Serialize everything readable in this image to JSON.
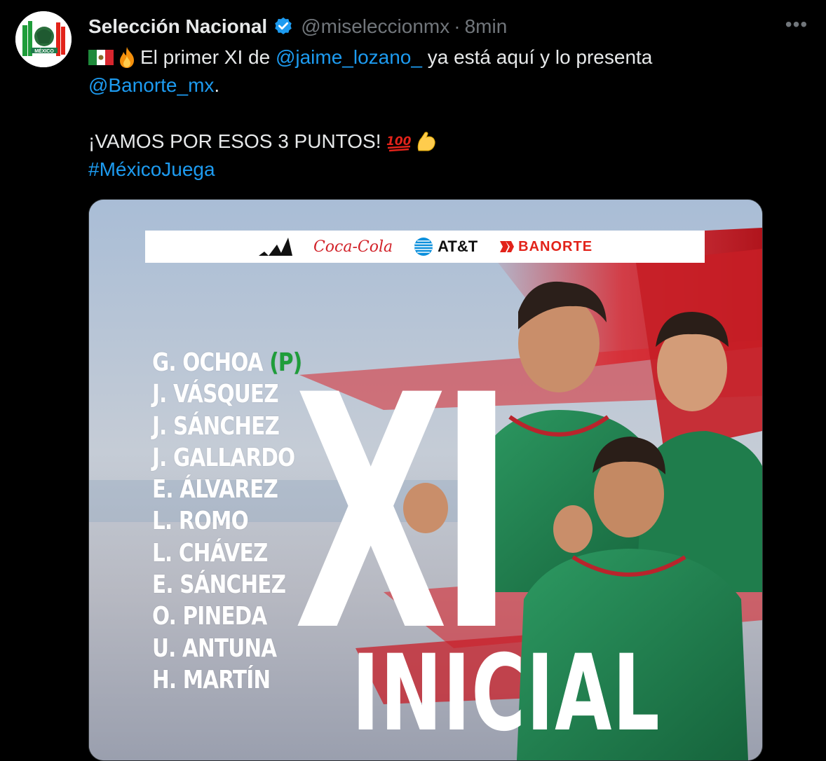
{
  "author": {
    "name": "Selección Nacional",
    "handle": "@miseleccionmx",
    "separator": "·",
    "time": "8min",
    "avatar_icon": "mexico-crest-icon"
  },
  "more_label": "•••",
  "tweet": {
    "line1_prefix": "El primer XI de ",
    "line1_mention": "@jaime_lozano_",
    "line1_suffix": " ya está aquí y lo presenta",
    "line2_mention": "@Banorte_mx",
    "line2_suffix": ".",
    "line3_text": "¡VAMOS POR ESOS 3 PUNTOS! ",
    "hashtag": "#MéxicoJuega"
  },
  "graphic": {
    "sponsors": {
      "coke": "Coca-Cola",
      "att": "AT&T",
      "banorte": "BANORTE"
    },
    "players": [
      {
        "name": "G. OCHOA ",
        "tag": "(P)"
      },
      {
        "name": "J. VÁSQUEZ",
        "tag": ""
      },
      {
        "name": "J. SÁNCHEZ",
        "tag": ""
      },
      {
        "name": "J. GALLARDO",
        "tag": ""
      },
      {
        "name": "E. ÁLVAREZ",
        "tag": ""
      },
      {
        "name": "L. ROMO",
        "tag": ""
      },
      {
        "name": "L. CHÁVEZ",
        "tag": ""
      },
      {
        "name": "E. SÁNCHEZ",
        "tag": ""
      },
      {
        "name": "O. PINEDA",
        "tag": ""
      },
      {
        "name": "U. ANTUNA",
        "tag": ""
      },
      {
        "name": "H. MARTÍN",
        "tag": ""
      }
    ],
    "big_title": "XI",
    "subtitle": "INICIAL"
  },
  "colors": {
    "link": "#1d9bf0",
    "verified": "#1d9bf0",
    "secondary": "#71767b",
    "jersey_green": "#1e7a4a",
    "accent_red": "#d8262e"
  }
}
